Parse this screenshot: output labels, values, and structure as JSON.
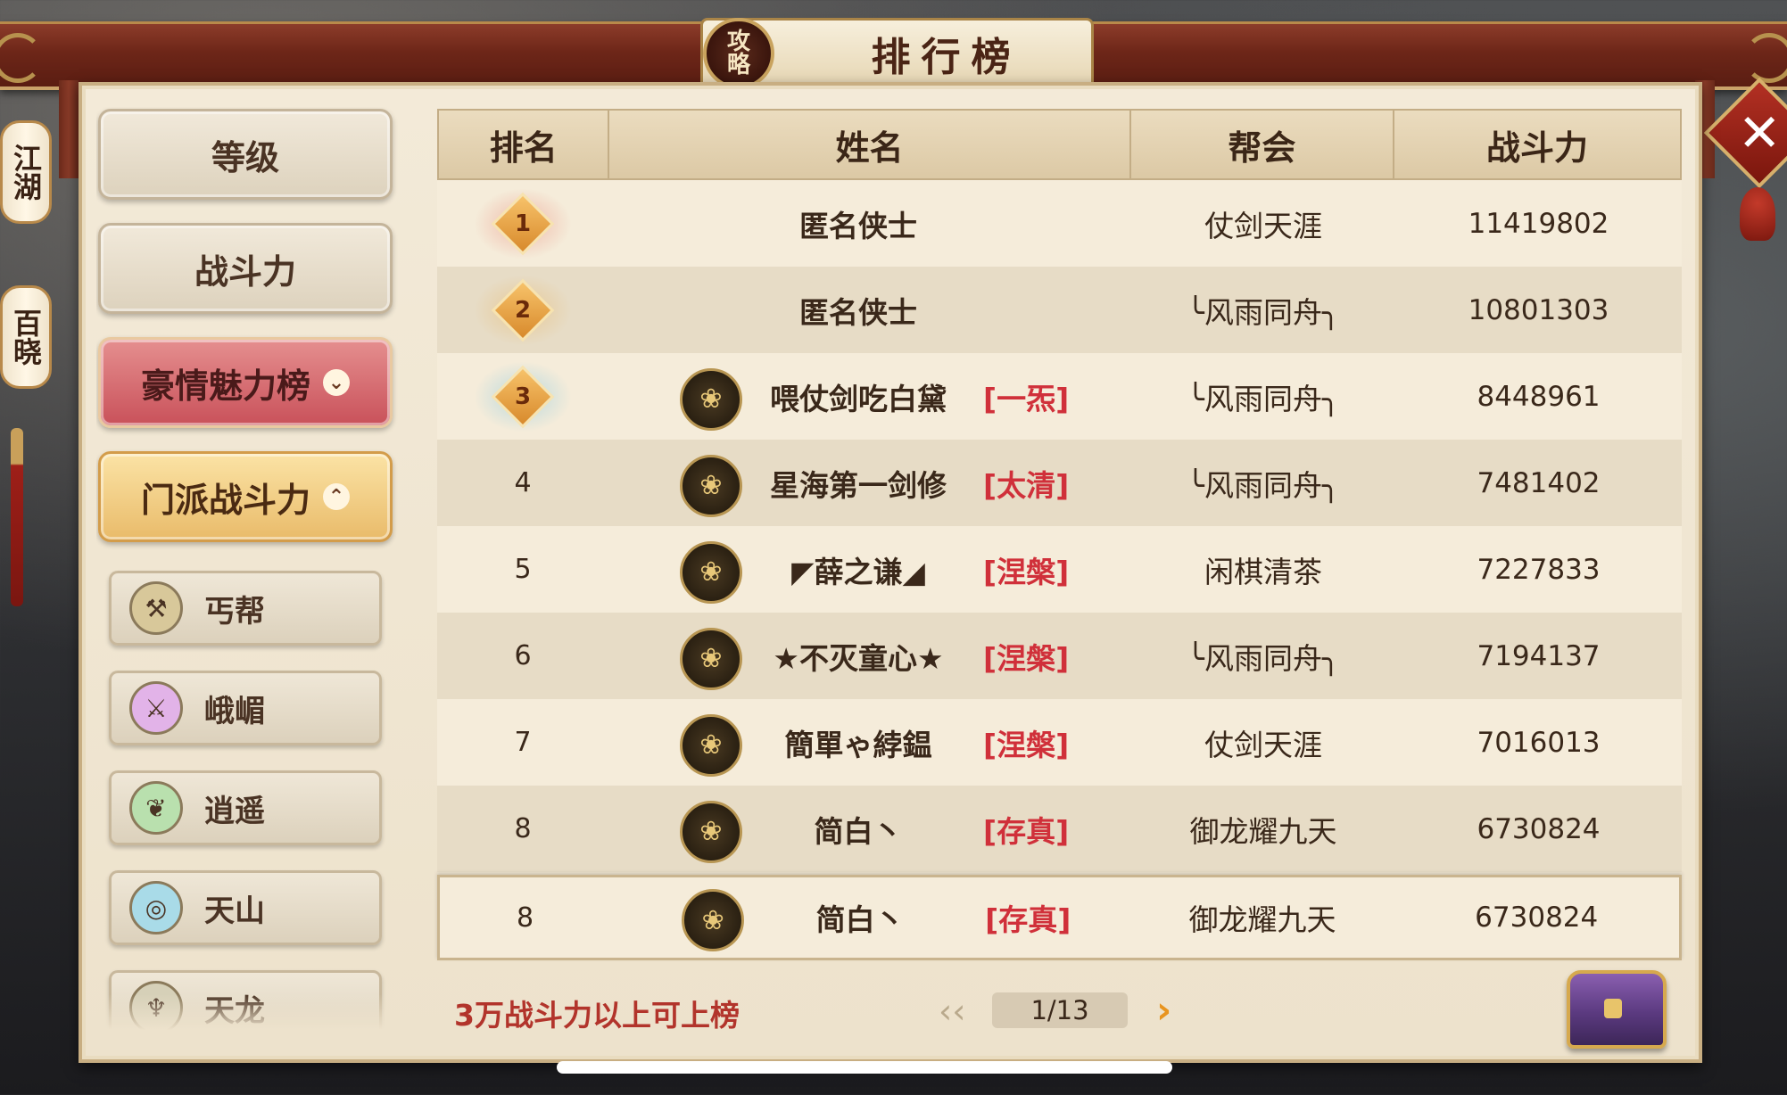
{
  "window": {
    "title": "排行榜",
    "guide_badge": "攻略",
    "close_icon": "close-icon"
  },
  "side_tabs": [
    {
      "label": "江湖"
    },
    {
      "label": "百晓"
    }
  ],
  "nav": {
    "categories": [
      {
        "label": "等级",
        "state": "normal"
      },
      {
        "label": "战斗力",
        "state": "normal"
      },
      {
        "label": "豪情魅力榜",
        "state": "pink",
        "chevron": "⌄"
      },
      {
        "label": "门派战斗力",
        "state": "gold",
        "chevron": "⌃"
      }
    ],
    "sects": [
      {
        "label": "丐帮",
        "icon": "staff-icon",
        "color": "#9b8a55"
      },
      {
        "label": "峨嵋",
        "icon": "sword-icon",
        "color": "#b04fc0"
      },
      {
        "label": "逍遥",
        "icon": "fan-icon",
        "color": "#4aa556"
      },
      {
        "label": "天山",
        "icon": "ring-icon",
        "color": "#3a9ec2"
      },
      {
        "label": "天龙",
        "icon": "dragon-icon",
        "color": "#8f8a6a"
      }
    ]
  },
  "table": {
    "headers": {
      "rank": "排名",
      "name": "姓名",
      "guild": "帮会",
      "power": "战斗力"
    },
    "rows": [
      {
        "rank": "1",
        "medal": true,
        "medal_color": "#e87a6a",
        "emblem": false,
        "name": "匿名侠士",
        "sect": "",
        "guild": "仗剑天涯",
        "power": "11419802"
      },
      {
        "rank": "2",
        "medal": true,
        "medal_color": "#e8b25a",
        "emblem": false,
        "name": "匿名侠士",
        "sect": "",
        "guild": "╰风雨同舟╮",
        "power": "10801303"
      },
      {
        "rank": "3",
        "medal": true,
        "medal_color": "#6fc1e0",
        "emblem": true,
        "name": "喂仗剑吃白黛",
        "sect": "[一炁]",
        "guild": "╰风雨同舟╮",
        "power": "8448961"
      },
      {
        "rank": "4",
        "medal": false,
        "emblem": true,
        "name": "星海第一剑修",
        "sect": "[太清]",
        "guild": "╰风雨同舟╮",
        "power": "7481402"
      },
      {
        "rank": "5",
        "medal": false,
        "emblem": true,
        "name": "◤薛之谦◢",
        "sect": "[涅槃]",
        "guild": "闲棋清茶",
        "power": "7227833"
      },
      {
        "rank": "6",
        "medal": false,
        "emblem": true,
        "name": "★不灭童心★",
        "sect": "[涅槃]",
        "guild": "╰风雨同舟╮",
        "power": "7194137"
      },
      {
        "rank": "7",
        "medal": false,
        "emblem": true,
        "name": "簡單ゃ綍鎾",
        "sect": "[涅槃]",
        "guild": "仗剑天涯",
        "power": "7016013"
      },
      {
        "rank": "8",
        "medal": false,
        "emblem": true,
        "name": "简白丶",
        "sect": "[存真]",
        "guild": "御龙耀九天",
        "power": "6730824"
      }
    ],
    "self_row": {
      "rank": "8",
      "emblem": true,
      "name": "简白丶",
      "sect": "[存真]",
      "guild": "御龙耀九天",
      "power": "6730824"
    }
  },
  "footer": {
    "note": "3万战斗力以上可上榜",
    "page": "1/13",
    "prev_icon": "‹‹",
    "next_icon": "›",
    "chest_icon": "treasure-chest-icon"
  },
  "colors": {
    "accent_red": "#d0303a",
    "beam": "#6d2618",
    "panel": "#f3ead8"
  }
}
